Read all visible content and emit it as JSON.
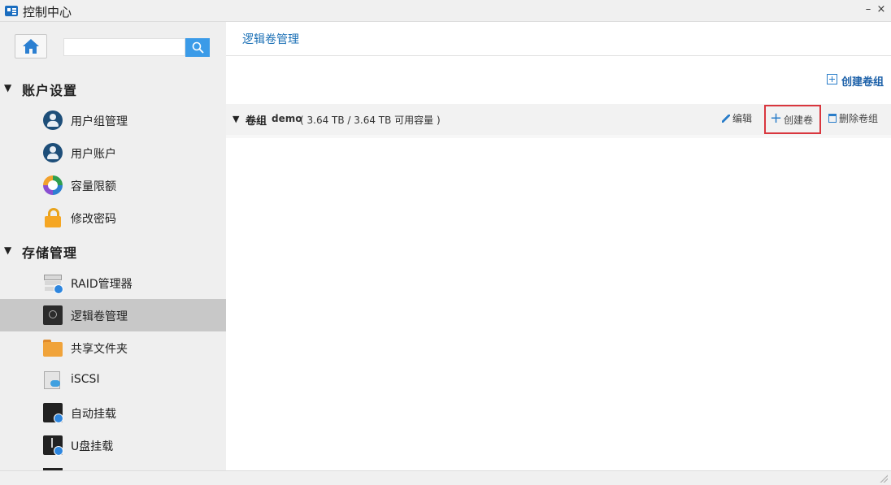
{
  "window": {
    "title": "控制中心",
    "minimize_glyph": "–",
    "close_glyph": "×"
  },
  "sidebar": {
    "search": {
      "value": "",
      "placeholder": ""
    },
    "sections": [
      {
        "label": "账户设置",
        "items": [
          {
            "label": "用户组管理",
            "icon": "user-group-icon"
          },
          {
            "label": "用户账户",
            "icon": "user-account-icon"
          },
          {
            "label": "容量限额",
            "icon": "quota-icon"
          },
          {
            "label": "修改密码",
            "icon": "lock-icon"
          }
        ]
      },
      {
        "label": "存储管理",
        "items": [
          {
            "label": "RAID管理器",
            "icon": "raid-icon"
          },
          {
            "label": "逻辑卷管理",
            "icon": "logical-volume-icon",
            "active": true
          },
          {
            "label": "共享文件夹",
            "icon": "shared-folder-icon"
          },
          {
            "label": "iSCSI",
            "icon": "iscsi-icon"
          },
          {
            "label": "自动挂载",
            "icon": "auto-mount-icon"
          },
          {
            "label": "U盘挂载",
            "icon": "usb-mount-icon"
          }
        ]
      }
    ]
  },
  "main": {
    "breadcrumb": "逻辑卷管理",
    "create_vg_label": "创建卷组",
    "volume_group": {
      "label": "卷组",
      "name": "demo",
      "capacity": "( 3.64 TB / 3.64 TB 可用容量 )",
      "actions": {
        "edit": "编辑",
        "create_volume": "创建卷",
        "delete_group": "删除卷组"
      }
    }
  },
  "colors": {
    "accent": "#1a6fb5",
    "highlight_border": "#d9363e",
    "active_item": "#c8c8c8",
    "search_button": "#3b9be8"
  }
}
